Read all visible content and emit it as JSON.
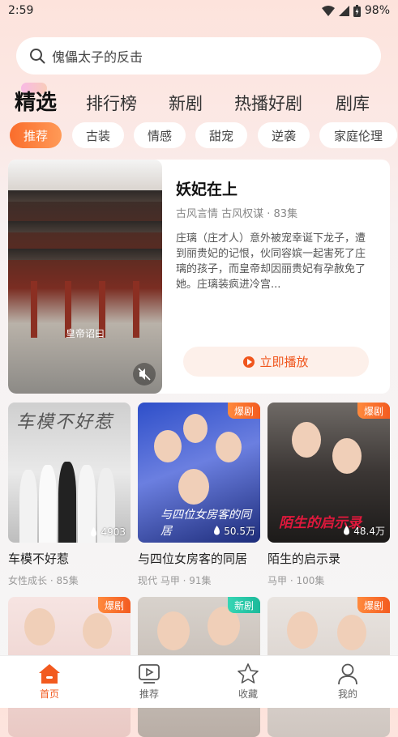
{
  "status": {
    "time": "2:59",
    "battery": "98%"
  },
  "search": {
    "placeholder": "傀儡太子的反击"
  },
  "tabs": [
    "精选",
    "排行榜",
    "新剧",
    "热播好剧",
    "剧库"
  ],
  "chips": [
    "推荐",
    "古装",
    "情感",
    "甜宠",
    "逆袭",
    "家庭伦理"
  ],
  "featured": {
    "poster_caption": "皇帝诏曰",
    "title": "妖妃在上",
    "meta": "古风言情 古风权谋 · 83集",
    "desc": "庄璃（庄才人）意外被宠幸诞下龙子，遭到丽贵妃的记恨，伙同容嫔一起害死了庄璃的孩子，而皇帝却因丽贵妃有孕赦免了她。庄璃装疯进冷宫...",
    "play_label": "立即播放"
  },
  "cards": [
    {
      "title": "车模不好惹",
      "meta": "女性成长 · 85集",
      "views": "4903",
      "badge": "",
      "poster_text": "车模不好惹"
    },
    {
      "title": "与四位女房客的同居",
      "meta": "现代 马甲 · 91集",
      "views": "50.5万",
      "badge": "爆剧",
      "poster_text": "与四位女房客的同居"
    },
    {
      "title": "陌生的启示录",
      "meta": "马甲 · 100集",
      "views": "48.4万",
      "badge": "爆剧",
      "poster_text": "陌生的启示录"
    },
    {
      "badge": "爆剧"
    },
    {
      "badge": "新剧"
    },
    {
      "badge": "爆剧"
    }
  ],
  "nav": [
    "首页",
    "推荐",
    "收藏",
    "我的"
  ],
  "colors": {
    "accent": "#f25a1f",
    "hot_badge": "#f35b20",
    "new_badge": "#1bb99a"
  }
}
